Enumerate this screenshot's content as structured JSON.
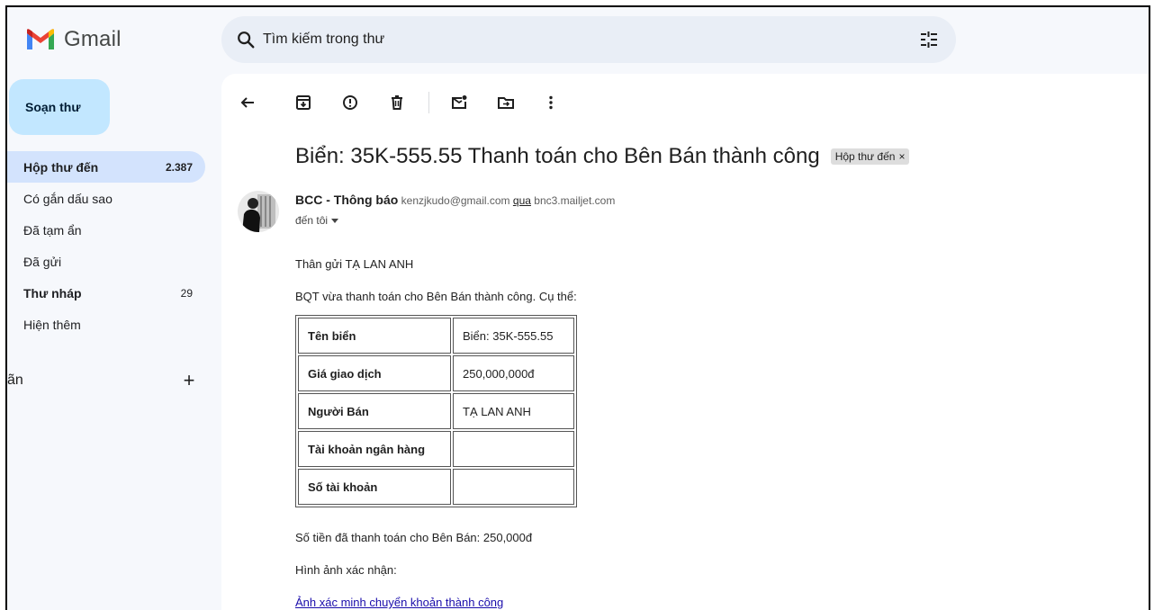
{
  "header": {
    "app_name": "Gmail",
    "search_placeholder": "Tìm kiếm trong thư"
  },
  "sidebar": {
    "compose_label": "Soạn thư",
    "items": [
      {
        "label": "Hộp thư đến",
        "count": "2.387"
      },
      {
        "label": "Có gắn dấu sao",
        "count": ""
      },
      {
        "label": "Đã tạm ẩn",
        "count": ""
      },
      {
        "label": "Đã gửi",
        "count": ""
      },
      {
        "label": "Thư nháp",
        "count": "29"
      },
      {
        "label": "Hiện thêm",
        "count": ""
      }
    ],
    "labels_title": "ãn",
    "labels_add": "+"
  },
  "email": {
    "subject": "Biển: 35K-555.55 Thanh toán cho Bên Bán thành công",
    "chip_label": "Hộp thư đến",
    "chip_close": "×",
    "sender_name": "BCC - Thông báo",
    "sender_email": "kenzjkudo@gmail.com",
    "via_word": "qua",
    "via_domain": "bnc3.mailjet.com",
    "to_line": "đến tôi",
    "greeting": "Thân gửi TẠ LAN ANH",
    "intro": "BQT vừa thanh toán cho Bên Bán thành công. Cụ thể:",
    "table": [
      {
        "key": "Tên biển",
        "value": "Biển: 35K-555.55"
      },
      {
        "key": "Giá giao dịch",
        "value": "250,000,000đ"
      },
      {
        "key": "Người Bán",
        "value": "TẠ LAN ANH"
      },
      {
        "key": "Tài khoản ngân hàng",
        "value": ""
      },
      {
        "key": "Số tài khoản",
        "value": ""
      }
    ],
    "paid_line": "Số tiền đã thanh toán cho Bên Bán: 250,000đ",
    "image_label": "Hình ảnh xác nhận:",
    "link_text": "Ảnh xác minh chuyển khoản thành công"
  },
  "colors": {
    "background": "#f6f8fc",
    "search_bg": "#e9eef6",
    "compose_bg": "#c2e7ff",
    "active_nav": "#d3e3fd"
  }
}
